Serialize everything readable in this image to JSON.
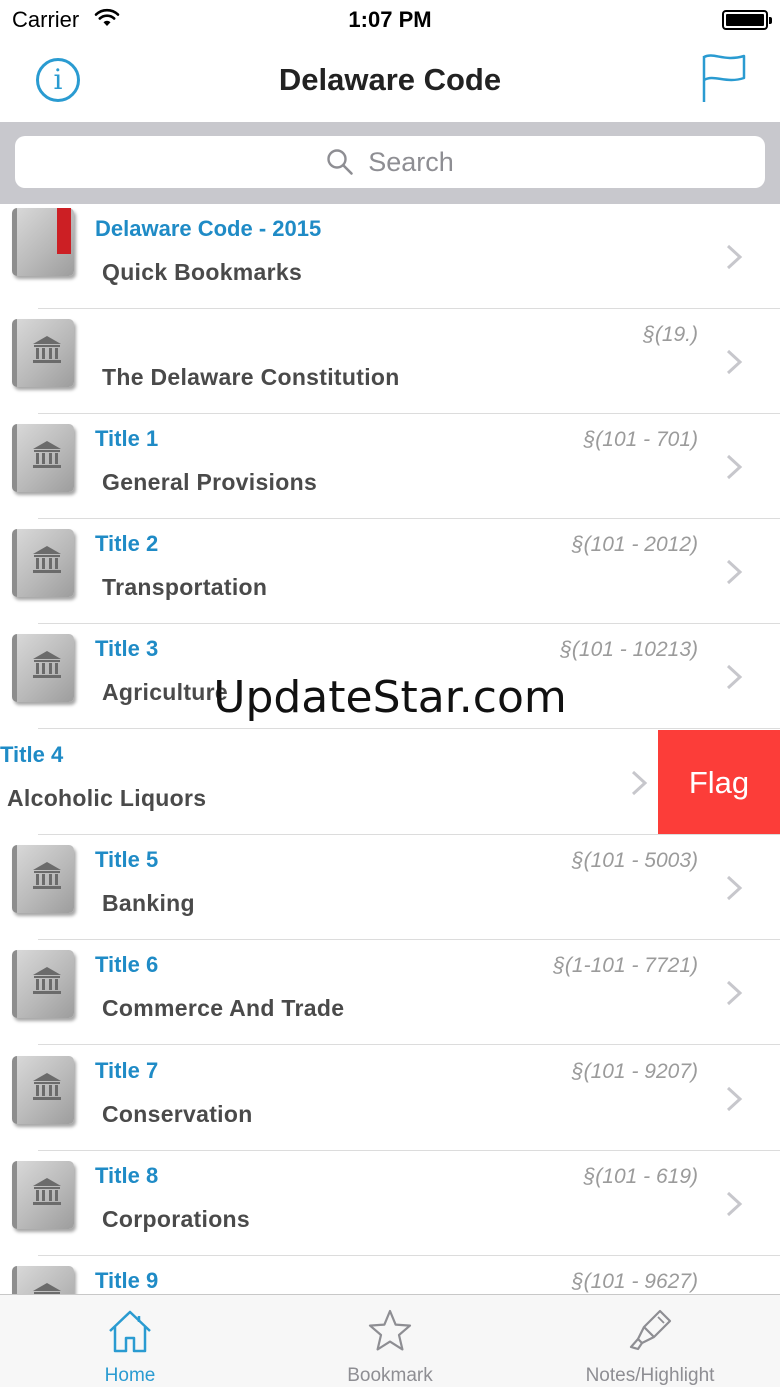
{
  "status_bar": {
    "carrier": "Carrier",
    "time": "1:07 PM"
  },
  "nav": {
    "title": "Delaware Code",
    "info_icon": "info-icon",
    "flag_icon": "flag-icon"
  },
  "search": {
    "placeholder": "Search"
  },
  "rows": [
    {
      "title": "Delaware Code - 2015",
      "subtitle": "Quick Bookmarks",
      "range": ""
    },
    {
      "title": "",
      "subtitle": "The Delaware Constitution",
      "range": "§(19.)"
    },
    {
      "title": "Title 1",
      "subtitle": "General Provisions",
      "range": "§(101 - 701)"
    },
    {
      "title": "Title 2",
      "subtitle": "Transportation",
      "range": "§(101 - 2012)"
    },
    {
      "title": "Title 3",
      "subtitle": "Agriculture",
      "range": "§(101 - 10213)"
    },
    {
      "title": "Title 4",
      "subtitle": "Alcoholic Liquors",
      "range": ""
    },
    {
      "title": "Title 5",
      "subtitle": "Banking",
      "range": "§(101 - 5003)"
    },
    {
      "title": "Title 6",
      "subtitle": "Commerce And Trade",
      "range": "§(1-101 - 7721)"
    },
    {
      "title": "Title 7",
      "subtitle": "Conservation",
      "range": "§(101 - 9207)"
    },
    {
      "title": "Title 8",
      "subtitle": "Corporations",
      "range": "§(101 - 619)"
    },
    {
      "title": "Title 9",
      "subtitle": "",
      "range": "§(101 - 9627)"
    }
  ],
  "swipe_action": {
    "label": "Flag",
    "color": "#fc3d39"
  },
  "watermark": "UpdateStar.com",
  "tabs": [
    {
      "label": "Home",
      "icon": "home-icon",
      "active": true
    },
    {
      "label": "Bookmark",
      "icon": "star-icon",
      "active": false
    },
    {
      "label": "Notes/Highlight",
      "icon": "highlighter-icon",
      "active": false
    }
  ],
  "colors": {
    "accent": "#2a9bd1",
    "title_blue": "#1f8bc6",
    "flag_red": "#fc3d39"
  }
}
